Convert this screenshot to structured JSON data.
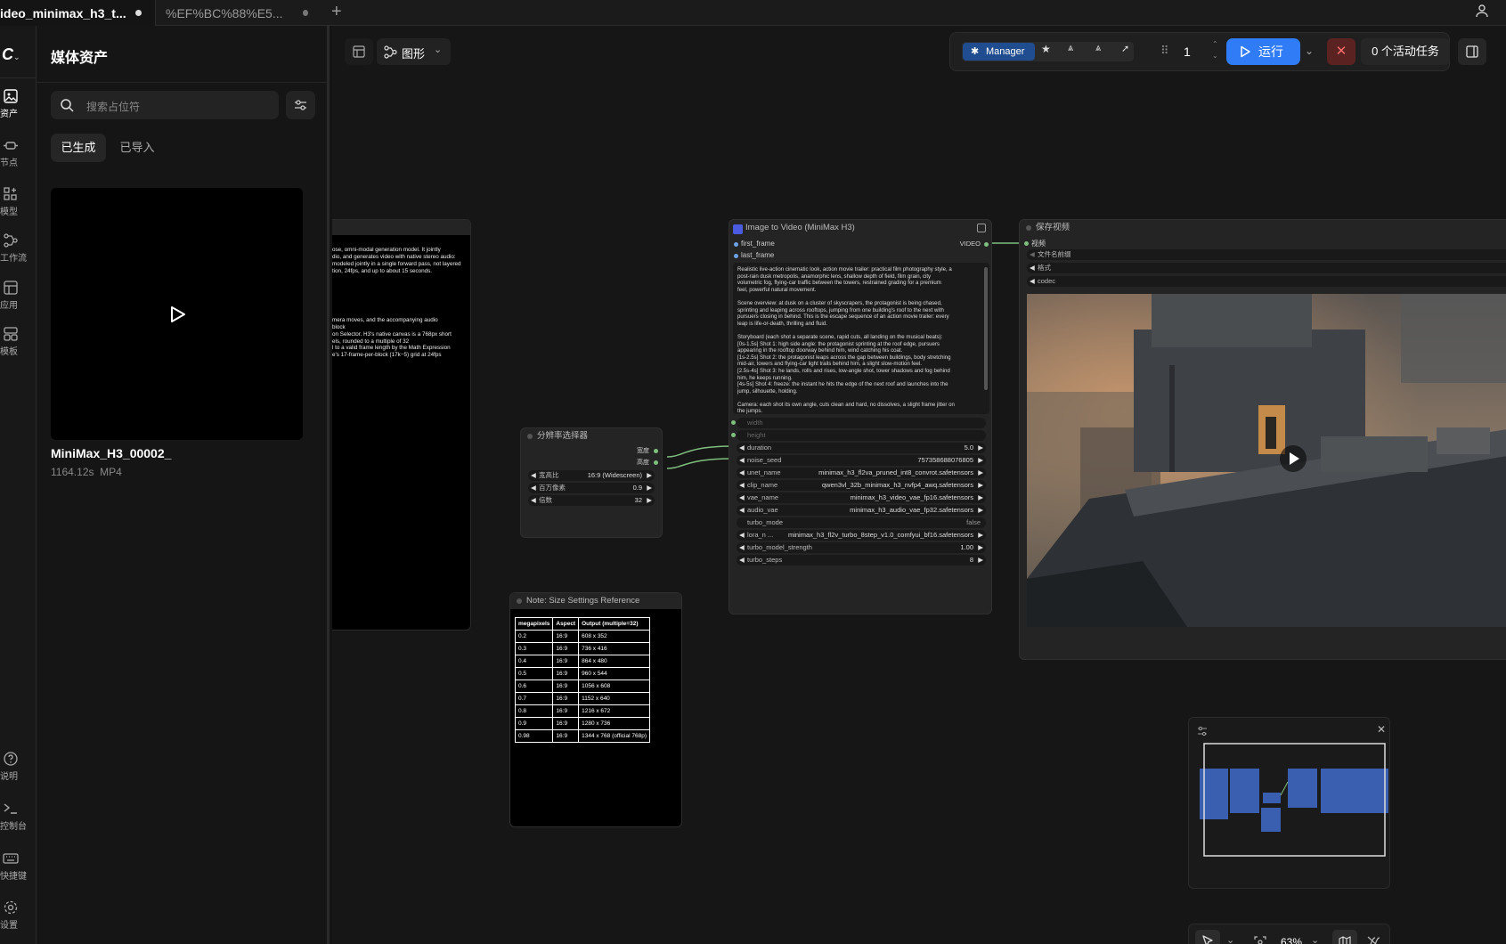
{
  "tabs": [
    {
      "label": "ideo_minimax_h3_t...",
      "active": true
    },
    {
      "label": "%EF%BC%88%E5...",
      "active": false
    }
  ],
  "rail": [
    {
      "label": "资产",
      "icon": "image-icon"
    },
    {
      "label": "节点",
      "icon": "node-icon"
    },
    {
      "label": "模型",
      "icon": "model-icon"
    },
    {
      "label": "工作流",
      "icon": "workflow-icon"
    },
    {
      "label": "应用",
      "icon": "app-icon"
    },
    {
      "label": "模板",
      "icon": "template-icon"
    },
    {
      "label": "说明",
      "icon": "help-icon"
    },
    {
      "label": "控制台",
      "icon": "terminal-icon"
    },
    {
      "label": "快捷键",
      "icon": "keyboard-icon"
    },
    {
      "label": "设置",
      "icon": "settings-icon"
    }
  ],
  "panel": {
    "title": "媒体资产",
    "search_placeholder": "搜索占位符",
    "tab_generated": "已生成",
    "tab_imported": "已导入",
    "asset_name": "MiniMax_H3_00002_",
    "asset_meta": "1164.12s  MP4"
  },
  "toolbar": {
    "graph_label": "图形",
    "manager_label": "Manager",
    "queue_count": "1",
    "run_label": "运行",
    "active_tasks": "0 个活动任务",
    "zoom": "63%"
  },
  "left_note_text": [
    "ose, omni-modal generation model. It jointly",
    "dio, and generates video with native stereo audio:",
    "modeled jointly in a single forward pass, not layered",
    "tion, 24fps, and up to about 15 seconds.",
    "",
    "",
    "",
    "",
    "",
    "",
    "mera moves, and the accompanying audio",
    "block",
    "on Selector. H3's native canvas is a 768px short",
    "els, rounded to a multiple of 32",
    "l to a valid frame length by the Math Expression",
    "e's 17-frame-per-block (17k−5) grid at 24fps"
  ],
  "resolution_node": {
    "title": "分辨率选择器",
    "out_width": "宽度",
    "out_height": "高度",
    "aspect_label": "宽高比",
    "aspect_value": "16:9 (Widescreen)",
    "mp_label": "百万像素",
    "mp_value": "0.9",
    "mult_label": "倍数",
    "mult_value": "32"
  },
  "size_note": {
    "title": "Note: Size Settings Reference",
    "headers": [
      "megapixels",
      "Aspect",
      "Output (multiple=32)"
    ],
    "rows": [
      [
        "0.2",
        "16:9",
        "608 x 352"
      ],
      [
        "0.3",
        "16:9",
        "736 x 416"
      ],
      [
        "0.4",
        "16:9",
        "864 x 480"
      ],
      [
        "0.5",
        "16:9",
        "960 x 544"
      ],
      [
        "0.6",
        "16:9",
        "1056 x 608"
      ],
      [
        "0.7",
        "16:9",
        "1152 x 640"
      ],
      [
        "0.8",
        "16:9",
        "1216 x 672"
      ],
      [
        "0.9",
        "16:9",
        "1280 x 736"
      ],
      [
        "0.98",
        "16:9",
        "1344 x 768 (official 768p)"
      ]
    ]
  },
  "i2v_node": {
    "title": "Image to Video (MiniMax H3)",
    "input_first": "first_frame",
    "input_last": "last_frame",
    "output": "VIDEO",
    "prompt": [
      "Realistic live-action cinematic look, action movie trailer: practical film photography style, a",
      "post-rain dusk metropolis, anamorphic lens, shallow depth of field, film grain, city",
      "volumetric fog, flying-car traffic between the towers, restrained grading for a premium",
      "feel, powerful natural movement.",
      "",
      "Scene overview: at dusk on a cluster of skyscrapers, the protagonist is being chased,",
      "sprinting and leaping across rooftops, jumping from one building's roof to the next with",
      "pursuers closing in behind. This is the escape sequence of an action movie trailer: every",
      "leap is life-or-death, thrilling and fluid.",
      "",
      "Storyboard (each shot a separate scene, rapid cuts, all landing on the musical beats):",
      "[0s-1.5s] Shot 1: high side angle: the protagonist sprinting at the roof edge, pursuers",
      "appearing in the rooftop doorway behind him, wind catching his coat.",
      "[1s-2.5s] Shot 2: the protagonist leaps across the gap between buildings, body stretching",
      "mid-air, towers and flying-car light trails behind him, a slight slow-motion feel.",
      "[2.5s-4s] Shot 3: he lands, rolls and rises, low-angle shot, tower shadows and fog behind",
      "him, he keeps running.",
      "[4s-5s] Shot 4: freeze: the instant he hits the edge of the next roof and launches into the",
      "jump, silhouette, holding.",
      "",
      "Camera: each shot its own angle, cuts clean and hard, no dissolves, a slight frame jitter on",
      "the jumps."
    ],
    "widgets": [
      {
        "label": "width",
        "value": "",
        "arrows": false,
        "dim": true
      },
      {
        "label": "height",
        "value": "",
        "arrows": false,
        "dim": true
      },
      {
        "label": "duration",
        "value": "5.0",
        "arrows": true
      },
      {
        "label": "noise_seed",
        "value": "757358688076805",
        "arrows": true
      },
      {
        "label": "unet_name",
        "value": "minimax_h3_fl2va_pruned_int8_convrot.safetensors",
        "arrows": true
      },
      {
        "label": "clip_name",
        "value": "qwen3vl_32b_minimax_h3_nvfp4_awq.safetensors",
        "arrows": true
      },
      {
        "label": "vae_name",
        "value": "minimax_h3_video_vae_fp16.safetensors",
        "arrows": true
      },
      {
        "label": "audio_vae",
        "value": "minimax_h3_audio_vae_fp32.safetensors",
        "arrows": true
      },
      {
        "label": "turbo_mode",
        "value": "false",
        "arrows": false
      },
      {
        "label": "lora_n ...",
        "value": "minimax_h3_fl2v_turbo_8step_v1.0_comfyui_bf16.safetensors",
        "arrows": true
      },
      {
        "label": "turbo_model_strength",
        "value": "1.00",
        "arrows": true
      },
      {
        "label": "turbo_steps",
        "value": "8",
        "arrows": true
      }
    ]
  },
  "save_node": {
    "title": "保存视频",
    "input": "视频",
    "w1": "文件名前缀",
    "w2": "格式",
    "w3": "codec"
  },
  "colors": {
    "accent": "#2f7cf6",
    "link": "#7fbf7f",
    "cancel": "#8b2b2b"
  }
}
